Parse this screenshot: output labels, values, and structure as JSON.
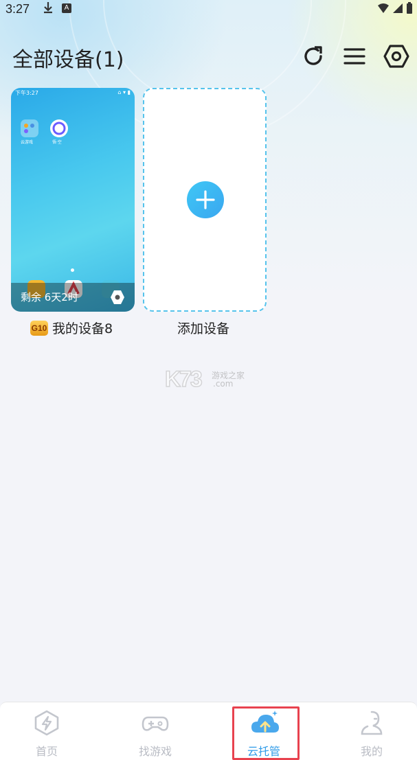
{
  "status_bar": {
    "time": "3:27"
  },
  "header": {
    "title": "全部设备(1)"
  },
  "device": {
    "mini_time": "下午3:27",
    "mini_icon_labels": [
      "云游戏",
      "悟·空"
    ],
    "remaining": "剩余 6天2时",
    "badge": "G10",
    "name": "我的设备8"
  },
  "add_device": {
    "label": "添加设备"
  },
  "watermark": {
    "brand": "K73",
    "site": "游戏之家",
    "domain": ".com"
  },
  "tabs": [
    {
      "label": "首页",
      "icon": "home-icon"
    },
    {
      "label": "找游戏",
      "icon": "gamepad-icon"
    },
    {
      "label": "云托管",
      "icon": "cloud-upload-icon",
      "active": true
    },
    {
      "label": "我的",
      "icon": "profile-icon"
    }
  ],
  "colors": {
    "accent": "#2f9be8",
    "highlight": "#e8424f",
    "dashed_border": "#55c3ec"
  }
}
